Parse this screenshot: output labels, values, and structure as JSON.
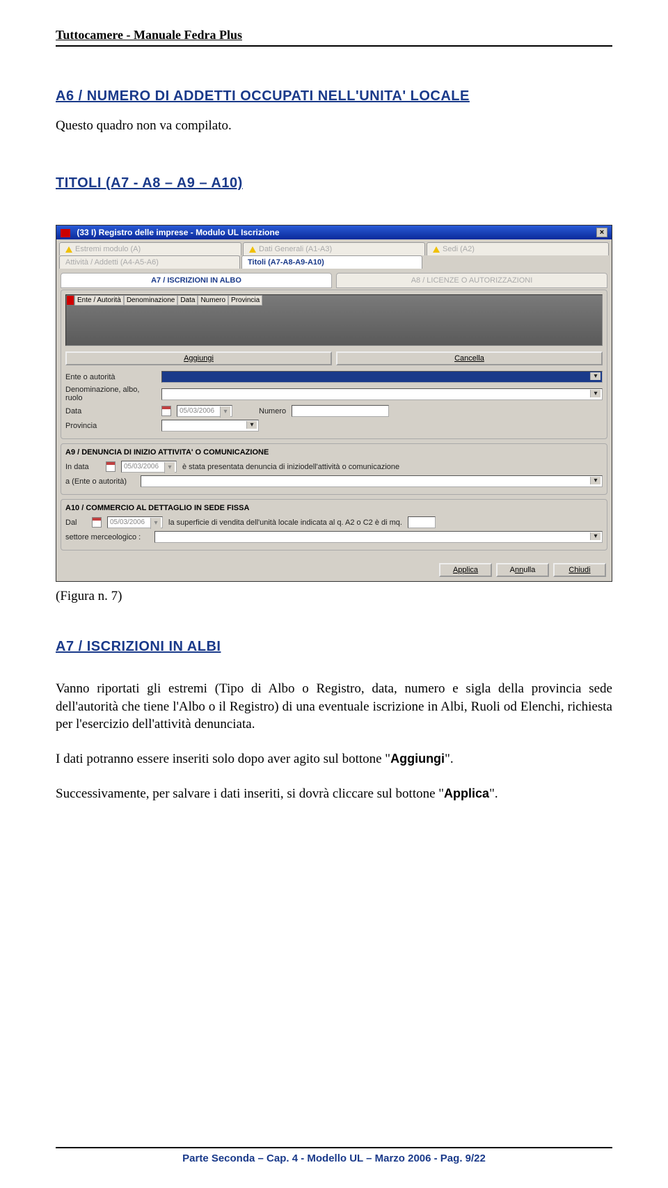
{
  "doc": {
    "header": "Tuttocamere - Manuale Fedra Plus",
    "sectionA6": "A6 / NUMERO DI ADDETTI OCCUPATI NELL'UNITA' LOCALE",
    "a6_text": "Questo quadro non va compilato.",
    "sectionTitoli": "TITOLI (A7 - A8 – A9 – A10)",
    "caption": "(Figura n. 7)",
    "sectionA7": "A7 / ISCRIZIONI IN ALBI",
    "para1": "Vanno riportati gli estremi (Tipo di Albo o Registro, data, numero e sigla della provincia sede dell'autorità che tiene l'Albo o il Registro) di una eventuale iscrizione in Albi, Ruoli od Elenchi, richiesta per l'esercizio dell'attività denunciata.",
    "para2_a": "I dati potranno essere inseriti solo dopo aver agito sul bottone \"",
    "para2_b": "Aggiungi",
    "para2_c": "\".",
    "para3_a": "Successivamente, per salvare i dati inseriti, si dovrà cliccare sul bottone \"",
    "para3_b": "Applica",
    "para3_c": "\".",
    "footer": "Parte Seconda – Cap. 4 - Modello UL – Marzo 2006 - Pag. 9/22"
  },
  "win": {
    "title": "(33 I) Registro delle imprese - Modulo UL Iscrizione",
    "tabs": {
      "t1": "Estremi modulo (A)",
      "t2": "Dati Generali (A1-A3)",
      "t3": "Sedi (A2)",
      "t4": "Attività / Addetti (A4-A5-A6)",
      "t5": "Titoli (A7-A8-A9-A10)"
    },
    "subtabs": {
      "a7": "A7 / ISCRIZIONI IN ALBO",
      "a8": "A8 / LICENZE O AUTORIZZAZIONI"
    },
    "grid": {
      "c1": "Ente / Autorità",
      "c2": "Denominazione",
      "c3": "Data",
      "c4": "Numero",
      "c5": "Provincia"
    },
    "btns": {
      "add": "Aggiungi",
      "del": "Cancella"
    },
    "form": {
      "ente": "Ente o autorità",
      "denom": "Denominazione, albo, ruolo",
      "data": "Data",
      "data_val": "05/03/2006",
      "numero": "Numero",
      "prov": "Provincia"
    },
    "a9": {
      "head": "A9 / DENUNCIA DI INIZIO ATTIVITA' O COMUNICAZIONE",
      "l1": "In data",
      "date": "05/03/2006",
      "l2": "è stata presentata denuncia di iniziodell'attività o comunicazione",
      "l3": "a (Ente o autorità)"
    },
    "a10": {
      "head": "A10 / COMMERCIO AL DETTAGLIO IN SEDE FISSA",
      "l1": "Dal",
      "date": "05/03/2006",
      "l2": "la superficie di vendita dell'unità locale indicata al q. A2 o C2 è di mq.",
      "l3": "settore merceologico :"
    },
    "dlg": {
      "applica": "Applica",
      "annulla": "Annulla",
      "chiudi": "Chiudi"
    }
  }
}
